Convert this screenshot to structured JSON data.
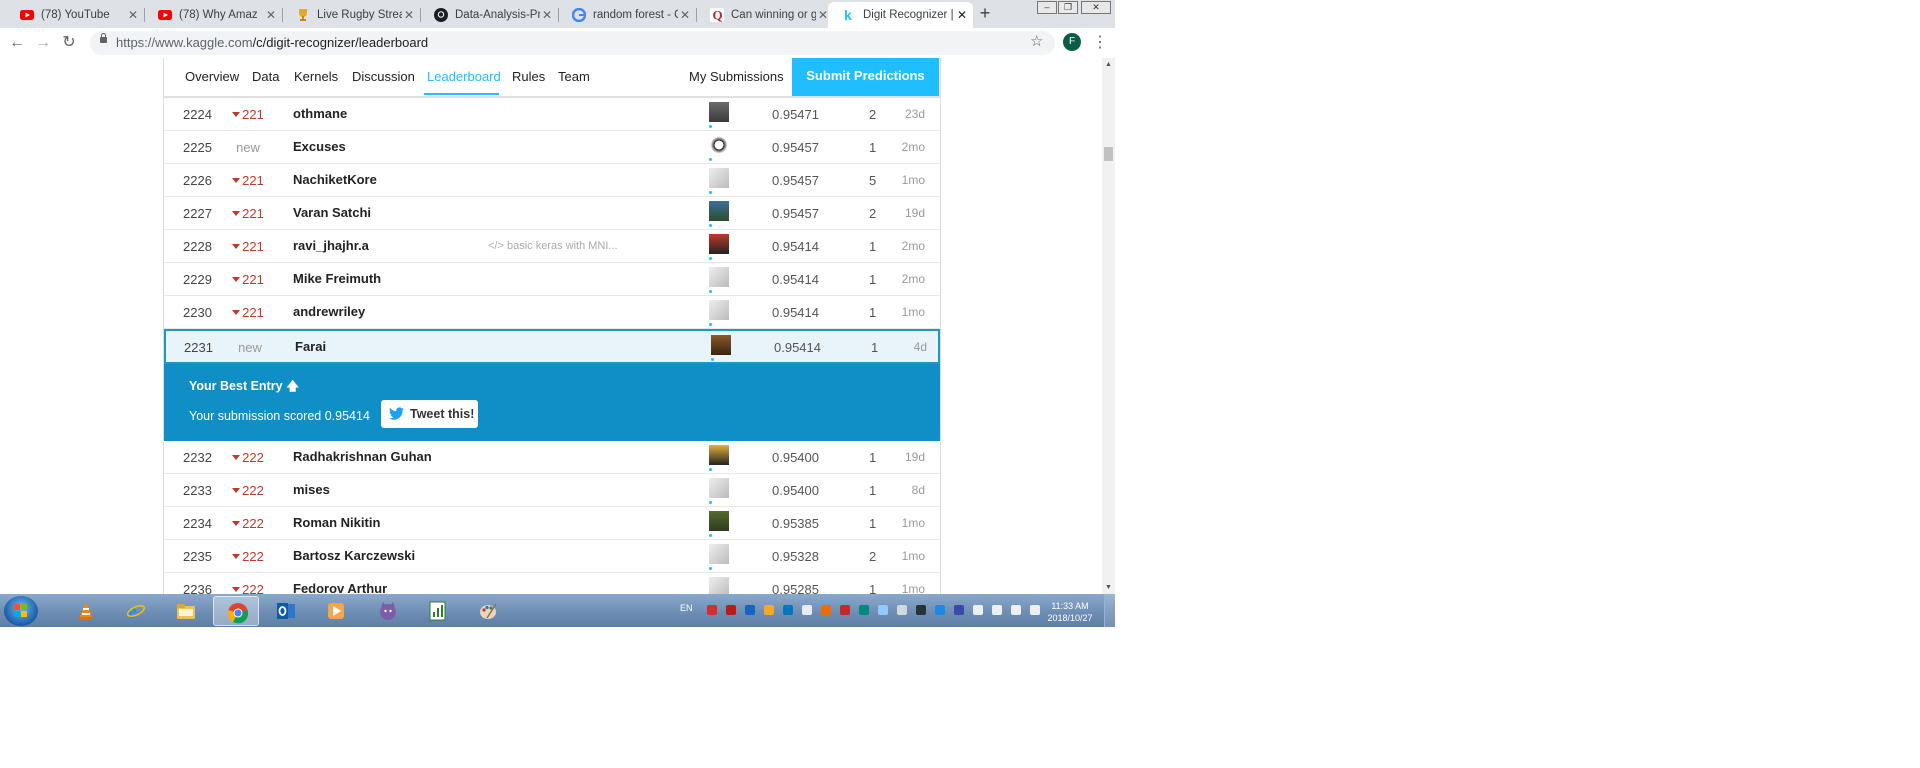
{
  "browser": {
    "tabs": [
      {
        "title": "(78) YouTube",
        "icon": "youtube-icon",
        "active": false
      },
      {
        "title": "(78) Why Amaz",
        "icon": "youtube-icon",
        "active": false
      },
      {
        "title": "Live Rugby Streami",
        "icon": "trophy-icon",
        "active": false
      },
      {
        "title": "Data-Analysis-Proje",
        "icon": "github-icon",
        "active": false
      },
      {
        "title": "random forest - Go",
        "icon": "google-icon",
        "active": false
      },
      {
        "title": "Can winning or get",
        "icon": "quora-icon",
        "active": false
      },
      {
        "title": "Digit Recognizer | K",
        "icon": "kaggle-icon",
        "active": true
      }
    ],
    "new_tab_label": "+",
    "url_host": "https://www.kaggle.com",
    "url_path": "/c/digit-recognizer/leaderboard",
    "profile_initial": "F"
  },
  "nav": {
    "items": [
      "Overview",
      "Data",
      "Kernels",
      "Discussion",
      "Leaderboard",
      "Rules",
      "Team"
    ],
    "active": "Leaderboard",
    "my_submissions": "My Submissions",
    "submit": "Submit Predictions"
  },
  "rows_before": [
    {
      "rank": "2224",
      "change": "221",
      "change_type": "down",
      "team": "othmane",
      "kernel": "",
      "score": "0.95471",
      "entries": "2",
      "last": "23d"
    },
    {
      "rank": "2225",
      "change": "new",
      "change_type": "new",
      "team": "Excuses",
      "kernel": "",
      "score": "0.95457",
      "entries": "1",
      "last": "2mo"
    },
    {
      "rank": "2226",
      "change": "221",
      "change_type": "down",
      "team": "NachiketKore",
      "kernel": "",
      "score": "0.95457",
      "entries": "5",
      "last": "1mo"
    },
    {
      "rank": "2227",
      "change": "221",
      "change_type": "down",
      "team": "Varan Satchi",
      "kernel": "",
      "score": "0.95457",
      "entries": "2",
      "last": "19d"
    },
    {
      "rank": "2228",
      "change": "221",
      "change_type": "down",
      "team": "ravi_jhajhr.a",
      "kernel": "</> basic keras with MNI...",
      "score": "0.95414",
      "entries": "1",
      "last": "2mo"
    },
    {
      "rank": "2229",
      "change": "221",
      "change_type": "down",
      "team": "Mike Freimuth",
      "kernel": "",
      "score": "0.95414",
      "entries": "1",
      "last": "2mo"
    },
    {
      "rank": "2230",
      "change": "221",
      "change_type": "down",
      "team": "andrewriley",
      "kernel": "",
      "score": "0.95414",
      "entries": "1",
      "last": "1mo"
    }
  ],
  "highlight_row": {
    "rank": "2231",
    "change": "new",
    "change_type": "new",
    "team": "Farai",
    "kernel": "",
    "score": "0.95414",
    "entries": "1",
    "last": "4d"
  },
  "best_entry": {
    "title": "Your Best Entry",
    "text": "Your submission scored 0.95414",
    "tweet_label": "Tweet this!"
  },
  "rows_after": [
    {
      "rank": "2232",
      "change": "222",
      "change_type": "down",
      "team": "Radhakrishnan Guhan",
      "kernel": "",
      "score": "0.95400",
      "entries": "1",
      "last": "19d"
    },
    {
      "rank": "2233",
      "change": "222",
      "change_type": "down",
      "team": "mises",
      "kernel": "",
      "score": "0.95400",
      "entries": "1",
      "last": "8d"
    },
    {
      "rank": "2234",
      "change": "222",
      "change_type": "down",
      "team": "Roman Nikitin",
      "kernel": "",
      "score": "0.95385",
      "entries": "1",
      "last": "1mo"
    },
    {
      "rank": "2235",
      "change": "222",
      "change_type": "down",
      "team": "Bartosz Karczewski",
      "kernel": "",
      "score": "0.95328",
      "entries": "2",
      "last": "1mo"
    },
    {
      "rank": "2236",
      "change": "222",
      "change_type": "down",
      "team": "Fedorov Arthur",
      "kernel": "",
      "score": "0.95285",
      "entries": "1",
      "last": "1mo"
    }
  ],
  "taskbar": {
    "apps": [
      "vlc-icon",
      "internet-explorer-icon",
      "file-explorer-icon",
      "chrome-icon",
      "outlook-icon",
      "media-player-icon",
      "cat-app-icon",
      "notepad-chart-icon",
      "paint-icon"
    ],
    "active_app": "chrome-icon",
    "language": "EN",
    "time": "11:33 AM",
    "date": "2018/10/27"
  },
  "colors": {
    "kaggle_blue": "#20beff",
    "best_entry_bg": "#0f8fc6",
    "rank_down": "#c0392b"
  }
}
